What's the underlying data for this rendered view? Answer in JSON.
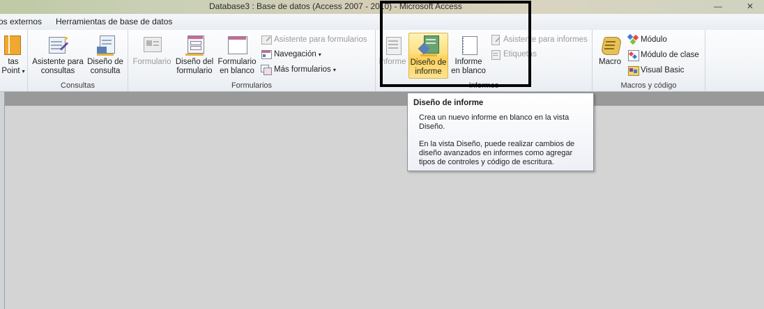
{
  "window": {
    "title": "Database3 : Base de datos (Access 2007 - 2010)  -  Microsoft Access",
    "minimize_glyph": "—",
    "close_glyph": "✕"
  },
  "tabs": [
    {
      "label": "os externos"
    },
    {
      "label": "Herramientas de base de datos"
    }
  ],
  "ribbon": {
    "partial": {
      "line1": "tas",
      "line2": "Point",
      "arrow": "▾"
    },
    "consultas": {
      "label": "Consultas",
      "asistente": {
        "line1": "Asistente para",
        "line2": "consultas"
      },
      "diseno": {
        "line1": "Diseño de",
        "line2": "consulta"
      }
    },
    "formularios": {
      "label": "Formularios",
      "formulario": {
        "line1": "Formulario"
      },
      "diseno": {
        "line1": "Diseño del",
        "line2": "formulario"
      },
      "blanco": {
        "line1": "Formulario",
        "line2": "en blanco"
      },
      "asistente": "Asistente para formularios",
      "navegacion": "Navegación",
      "mas": "Más formularios"
    },
    "informes": {
      "label": "Informes",
      "informe": {
        "line1": "Informe"
      },
      "diseno": {
        "line1": "Diseño de",
        "line2": "informe"
      },
      "blanco": {
        "line1": "Informe",
        "line2": "en blanco"
      },
      "asistente": "Asistente para informes",
      "etiquetas": "Etiquetas"
    },
    "macros": {
      "label": "Macros y código",
      "macro": {
        "line1": "Macro"
      },
      "modulo": "Módulo",
      "modulo_clase": "Módulo de clase",
      "visual_basic": "Visual Basic"
    },
    "dropdown_arrow": "▾"
  },
  "tooltip": {
    "title": "Diseño de informe",
    "p1": "Crea un nuevo informe en blanco en la vista Diseño.",
    "p2": "En la vista Diseño, puede realizar cambios de diseño avanzados en informes como agregar tipos de controles y código de escritura."
  },
  "colors": {
    "hot_button": "#fdd15a",
    "highlight_box": "#000000",
    "workspace": "#d4d4d4"
  }
}
